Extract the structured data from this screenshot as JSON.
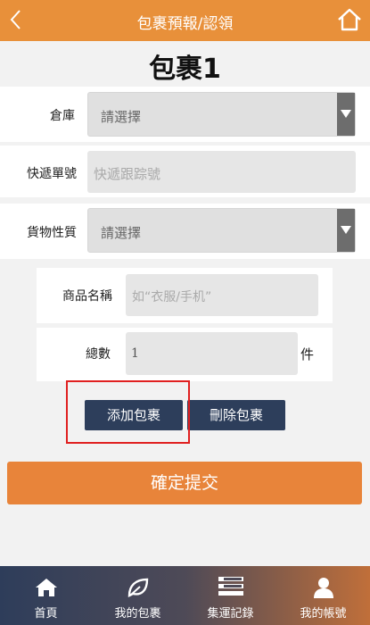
{
  "header": {
    "title": "包裹預報/認領"
  },
  "package": {
    "title": "包裹1"
  },
  "form": {
    "warehouse": {
      "label": "倉庫",
      "value": "請選擇"
    },
    "tracking": {
      "label": "快遞單號",
      "placeholder": "快遞跟踪號"
    },
    "cargo_type": {
      "label": "貨物性質",
      "value": "請選擇"
    }
  },
  "item": {
    "name_label": "商品名稱",
    "name_placeholder": "如“衣服/手机”",
    "qty_label": "總數",
    "qty_value": "1",
    "qty_unit": "件"
  },
  "actions": {
    "add": "添加包裹",
    "delete": "刪除包裹",
    "submit": "確定提交"
  },
  "tabs": [
    {
      "label": "首頁",
      "icon": "home-icon"
    },
    {
      "label": "我的包裹",
      "icon": "leaf-icon"
    },
    {
      "label": "集運記錄",
      "icon": "list-icon"
    },
    {
      "label": "我的帳號",
      "icon": "user-icon"
    }
  ],
  "colors": {
    "header": "#e8903a",
    "submit": "#e8843a",
    "button": "#2d3e5b",
    "highlight": "#e02020"
  }
}
